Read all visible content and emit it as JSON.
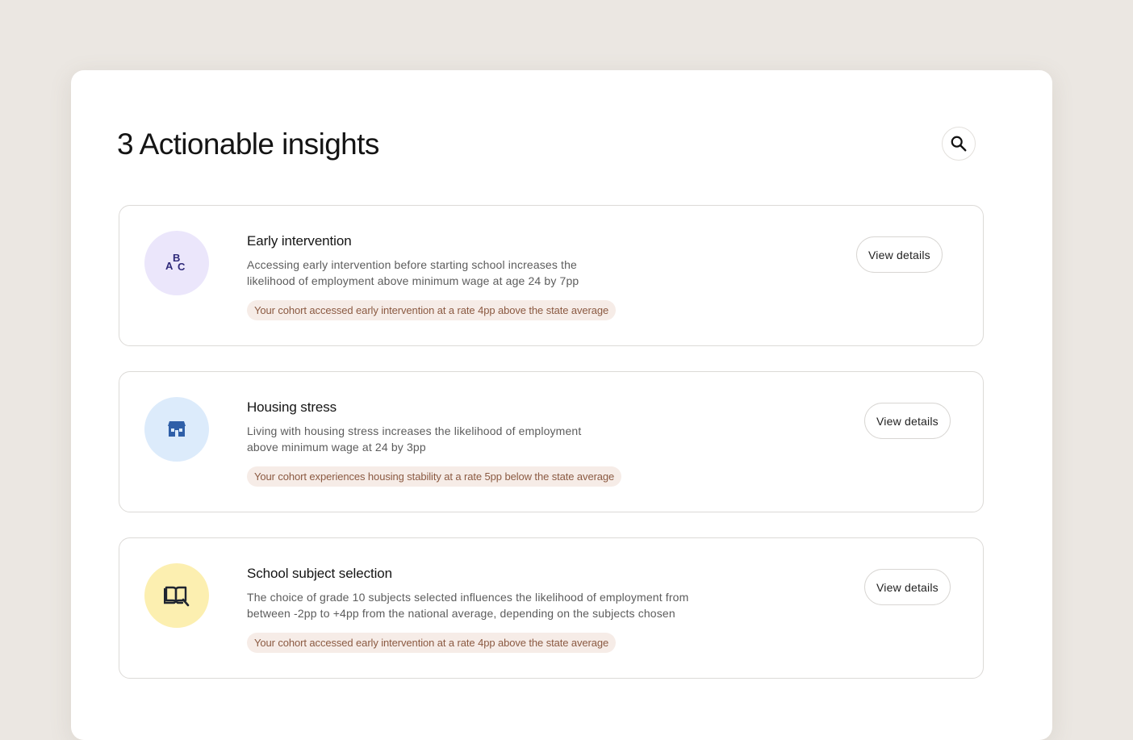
{
  "page": {
    "title": "3 Actionable insights",
    "search_icon": "search-icon"
  },
  "colors": {
    "badge_bg": "#f6ece7",
    "badge_text": "#8b5a42",
    "icon_purple_bg": "#ebe6fb",
    "icon_blue_bg": "#dcebfb",
    "icon_yellow_bg": "#fcefb0"
  },
  "insights": [
    {
      "icon": "abc-letters-icon",
      "icon_letters": [
        "A",
        "B",
        "C"
      ],
      "title": "Early intervention",
      "description_line1": "Accessing early intervention before starting school increases the",
      "description_line2": "likelihood of employment above minimum wage at age 24 by 7pp",
      "badge": "Your cohort accessed early intervention at a rate 4pp above the state average",
      "button_label": "View details"
    },
    {
      "icon": "house-icon",
      "title": "Housing stress",
      "description_line1": "Living with housing stress increases the likelihood of employment",
      "description_line2": "above minimum wage at 24 by 3pp",
      "badge": "Your cohort experiences housing stability at a rate 5pp below the state average",
      "button_label": "View details"
    },
    {
      "icon": "open-book-icon",
      "title": "School subject selection",
      "description_line1": "The choice of grade 10 subjects selected influences the likelihood of employment from",
      "description_line2": "between -2pp to +4pp from the national average, depending on the subjects chosen",
      "badge": "Your cohort accessed early intervention at a rate 4pp above the state average",
      "button_label": "View details"
    }
  ]
}
